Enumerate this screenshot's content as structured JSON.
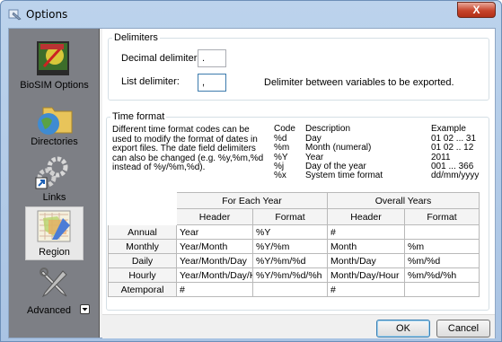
{
  "window": {
    "title": "Options",
    "close_label": "X"
  },
  "sidebar": {
    "items": [
      {
        "label": "BioSIM Options",
        "active": false
      },
      {
        "label": "Directories",
        "active": false
      },
      {
        "label": "Links",
        "active": false
      },
      {
        "label": "Region",
        "active": true
      },
      {
        "label": "Advanced",
        "active": false
      }
    ]
  },
  "delimiters": {
    "legend": "Delimiters",
    "decimal_label": "Decimal delimiter:",
    "decimal_value": ".",
    "list_label": "List delimiter:",
    "list_value": ",",
    "list_hint": "Delimiter between variables to be exported."
  },
  "time_format": {
    "legend": "Time format",
    "description": "Different time format codes can be used to modify the format of dates in export files. The date field delimiters can also be changed (e.g. %y,%m,%d instead of %y/%m,%d).",
    "codes_header": [
      "Code",
      "Description",
      "Example"
    ],
    "codes": [
      [
        "%d",
        "Day",
        "01  02 ... 31"
      ],
      [
        "%m",
        "Month (numeral)",
        "01  02 .. 12"
      ],
      [
        "%Y",
        "Year",
        "2011"
      ],
      [
        "%j",
        "Day of the year",
        "001 ... 366"
      ],
      [
        "%x",
        "System time format",
        "dd/mm/yyyy"
      ]
    ],
    "group_headers": [
      "For Each Year",
      "Overall Years"
    ],
    "sub_headers": [
      "Header",
      "Format",
      "Header",
      "Format"
    ],
    "rows": [
      {
        "name": "Annual",
        "cells": [
          "Year",
          "%Y",
          "#",
          ""
        ]
      },
      {
        "name": "Monthly",
        "cells": [
          "Year/Month",
          "%Y/%m",
          "Month",
          "%m"
        ]
      },
      {
        "name": "Daily",
        "cells": [
          "Year/Month/Day",
          "%Y/%m/%d",
          "Month/Day",
          "%m/%d"
        ]
      },
      {
        "name": "Hourly",
        "cells": [
          "Year/Month/Day/H",
          "%Y/%m/%d/%h",
          "Month/Day/Hour",
          "%m/%d/%h"
        ]
      },
      {
        "name": "Atemporal",
        "cells": [
          "#",
          "",
          "#",
          ""
        ]
      }
    ]
  },
  "footer": {
    "ok_label": "OK",
    "cancel_label": "Cancel"
  }
}
